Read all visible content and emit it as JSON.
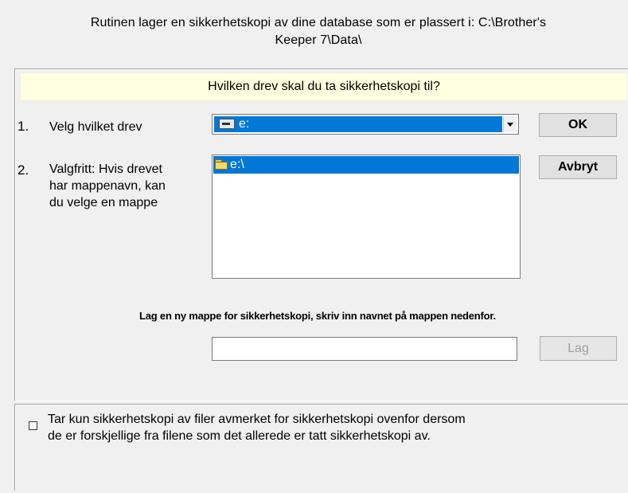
{
  "intro": {
    "line1": "Rutinen lager en sikkerhetskopi av dine database som er plassert i: C:\\Brother's",
    "line2": "Keeper 7\\Data\\"
  },
  "prompt": "Hvilken drev skal du ta sikkerhetskopi til?",
  "step1": {
    "number": "1.",
    "label": "Velg hvilket drev",
    "drive_value": "e:",
    "drive_icon": "drive-icon"
  },
  "step2": {
    "number": "2.",
    "label_line1": "Valgfritt:  Hvis drevet",
    "label_line2": "har mappenavn, kan",
    "label_line3": "du velge en mappe",
    "folders": [
      {
        "label": "e:\\",
        "icon": "open-folder-icon",
        "selected": true
      }
    ]
  },
  "buttons": {
    "ok": "OK",
    "cancel": "Avbryt",
    "create": "Lag"
  },
  "new_folder": {
    "label": "Lag en ny mappe for sikkerhetskopi, skriv inn navnet på mappen nedenfor.",
    "value": ""
  },
  "option": {
    "checked": false,
    "line1": "Tar kun sikkerhetskopi av filer avmerket for sikkerhetskopi ovenfor dersom",
    "line2": "de er forskjellige fra filene som det allerede er tatt sikkerhetskopi av."
  },
  "colors": {
    "selection": "#0078d7",
    "prompt_background": "#ffffe1",
    "dialog_background": "#f0f0f0"
  }
}
